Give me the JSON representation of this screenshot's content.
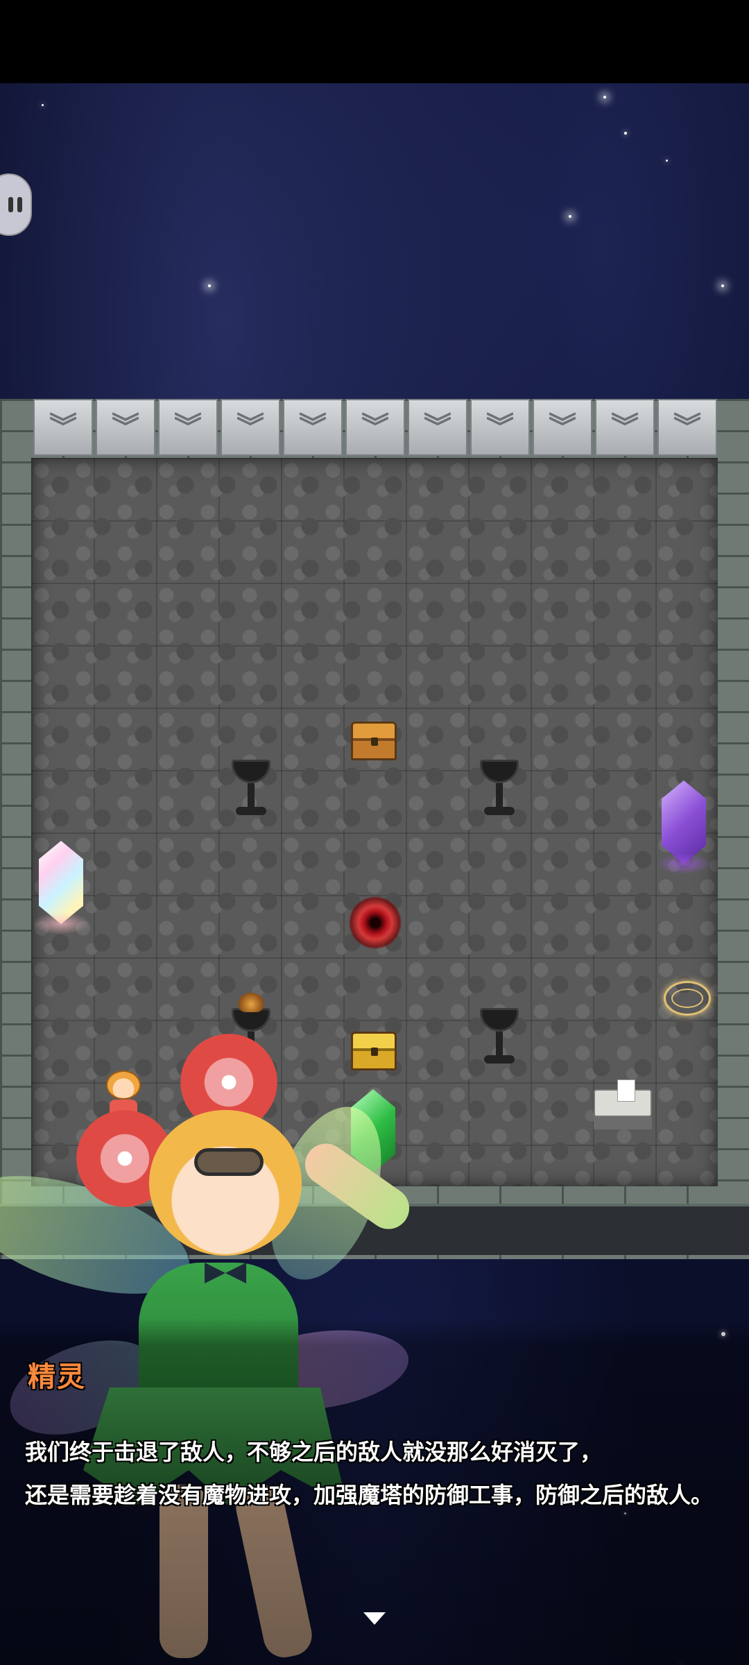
{
  "dialog": {
    "speaker": "精灵",
    "line1": "我们终于击退了敌人，不够之后的敌人就没那么好消灭了，",
    "line2": "还是需要趁着没有魔物进攻，加强魔塔的防御工事，防御之后的敌人。"
  },
  "icons": {
    "menu": "pause-menu-icon",
    "gate": "down-chevron-gate-icon",
    "advance": "triangle-down-icon"
  },
  "map": {
    "gate_count": 11,
    "gate_glyph": "︾"
  },
  "colors": {
    "speaker": "#ff8a3d",
    "text": "#ffffff",
    "space": "#0b0f2a",
    "wall": "#6f7a75",
    "floor": "#5a5a5a"
  }
}
